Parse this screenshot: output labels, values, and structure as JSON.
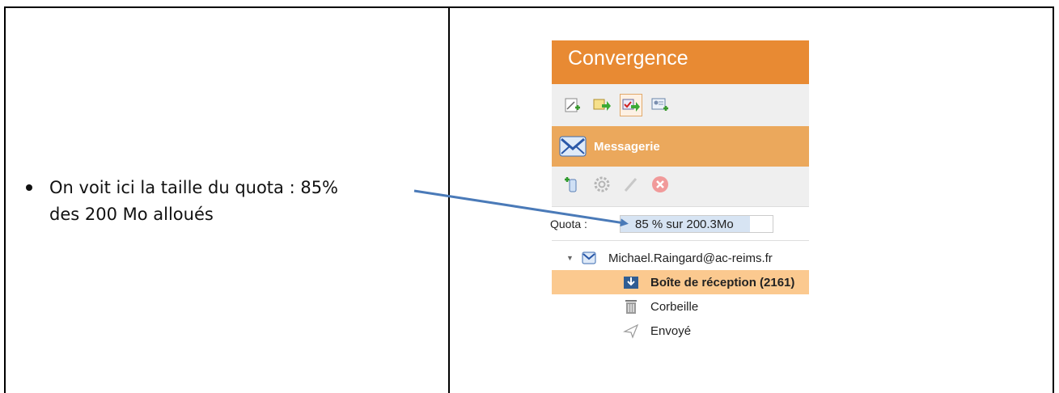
{
  "document": {
    "bullet_lines": [
      "On voit ici la taille du quota : 85%",
      "des 200 Mo alloués"
    ]
  },
  "app": {
    "title": "Convergence",
    "colors": {
      "header": "#e88a33",
      "section": "#eba85c",
      "selected": "#fbc98f",
      "arrow": "#4a7ab8"
    },
    "toolbar_icons": [
      "new-message-icon",
      "new-event-icon",
      "new-task-icon",
      "new-contact-icon"
    ],
    "section": {
      "label": "Messagerie",
      "icon": "mail-icon"
    },
    "folder_toolbar_icons": [
      "new-folder-icon",
      "settings-gear-icon",
      "rename-pencil-icon",
      "delete-icon"
    ],
    "quota": {
      "label": "Quota :",
      "text": "85 % sur 200.3Mo",
      "percent": 85
    },
    "account": "Michael.Raingard@ac-reims.fr",
    "folders": [
      {
        "label": "Boîte de réception (2161)",
        "icon": "inbox-icon",
        "selected": true
      },
      {
        "label": "Corbeille",
        "icon": "trash-icon",
        "selected": false
      },
      {
        "label": "Envoyé",
        "icon": "sent-icon",
        "selected": false
      }
    ]
  }
}
